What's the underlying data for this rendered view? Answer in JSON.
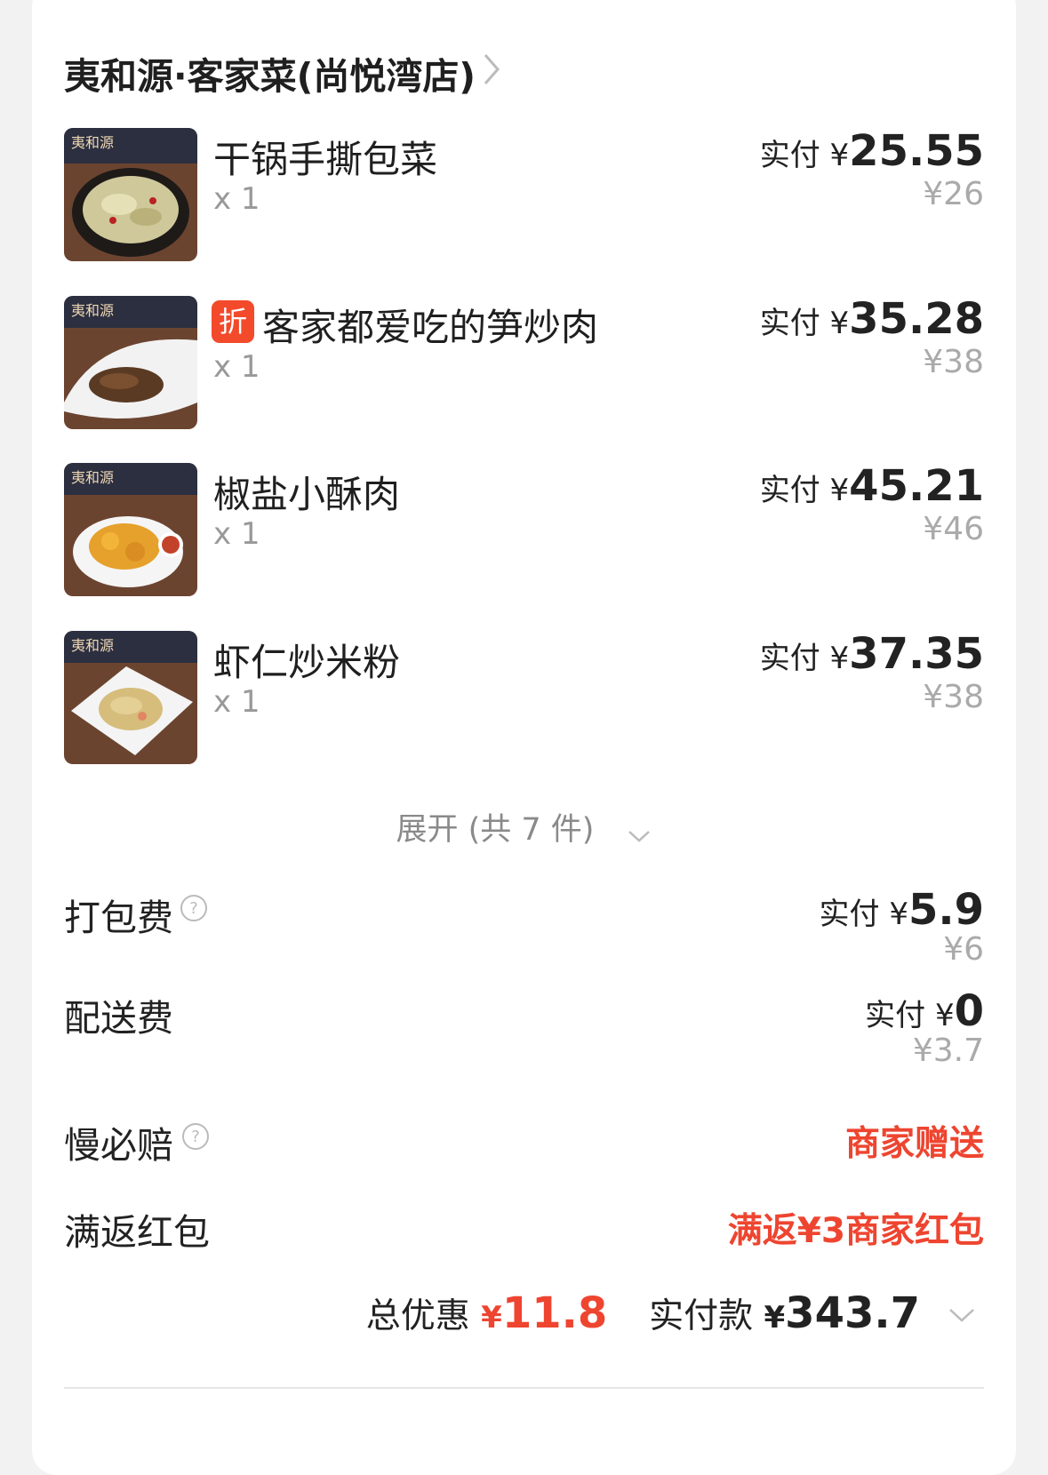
{
  "store": {
    "name": "夷和源·客家菜(尚悦湾店)"
  },
  "items": [
    {
      "name": "干锅手撕包菜",
      "qty": "x 1",
      "paid_label": "实付 ¥",
      "paid": "25.55",
      "original": "¥26",
      "discount_tag": ""
    },
    {
      "name": "客家都爱吃的笋炒肉",
      "qty": "x 1",
      "paid_label": "实付 ¥",
      "paid": "35.28",
      "original": "¥38",
      "discount_tag": "折"
    },
    {
      "name": "椒盐小酥肉",
      "qty": "x 1",
      "paid_label": "实付 ¥",
      "paid": "45.21",
      "original": "¥46",
      "discount_tag": ""
    },
    {
      "name": "虾仁炒米粉",
      "qty": "x 1",
      "paid_label": "实付 ¥",
      "paid": "37.35",
      "original": "¥38",
      "discount_tag": ""
    }
  ],
  "thumb_watermark": "夷和源",
  "expand": {
    "label": "展开 (共 7 件)"
  },
  "fees": {
    "packing": {
      "label": "打包费",
      "paid_label": "实付 ¥",
      "paid": "5.9",
      "original": "¥6"
    },
    "delivery": {
      "label": "配送费",
      "paid_label": "实付 ¥",
      "paid": "0",
      "original": "¥3.7"
    },
    "slow_compensation": {
      "label": "慢必赔",
      "value": "商家赠送"
    },
    "red_packet": {
      "label": "满返红包",
      "value": "满返¥3商家红包"
    }
  },
  "summary": {
    "discount_label": "总优惠",
    "discount_currency": "¥",
    "discount_value": "11.8",
    "paid_label": "实付款",
    "paid_currency": "¥",
    "paid_value": "343.7"
  },
  "colors": {
    "accent_red": "#ee4530",
    "tag_red": "#f24a2b",
    "muted": "#999999"
  }
}
